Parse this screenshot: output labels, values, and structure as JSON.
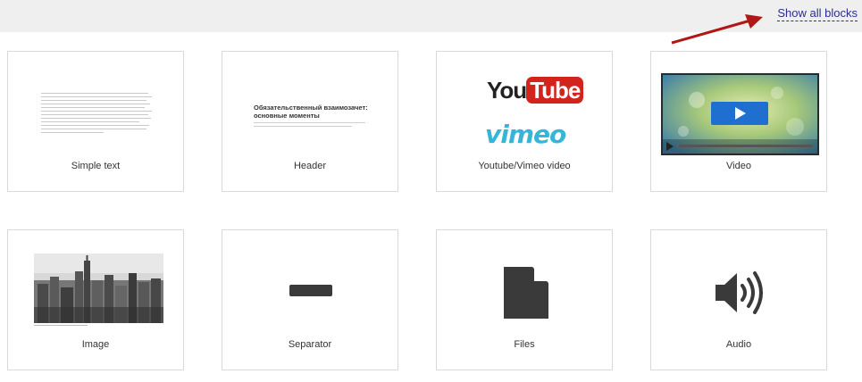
{
  "header": {
    "show_all_label": "Show all blocks"
  },
  "cards": [
    {
      "label": "Simple text"
    },
    {
      "label": "Header",
      "preview_title": "Обязательственный взаимозачет: основные моменты"
    },
    {
      "label": "Youtube/Vimeo video",
      "youtube_text_you": "You",
      "youtube_text_tube": "Tube",
      "vimeo_text": "vimeo"
    },
    {
      "label": "Video"
    },
    {
      "label": "Image"
    },
    {
      "label": "Separator"
    },
    {
      "label": "Files"
    },
    {
      "label": "Audio"
    }
  ],
  "colors": {
    "link": "#2a2f8f",
    "arrow": "#b01818",
    "youtube_red": "#d3231d",
    "vimeo_blue": "#35b6d9",
    "icon_dark": "#3a3a3a"
  },
  "icons": [
    "arrow-icon",
    "play-icon",
    "separator-icon",
    "file-icon",
    "speaker-icon"
  ]
}
